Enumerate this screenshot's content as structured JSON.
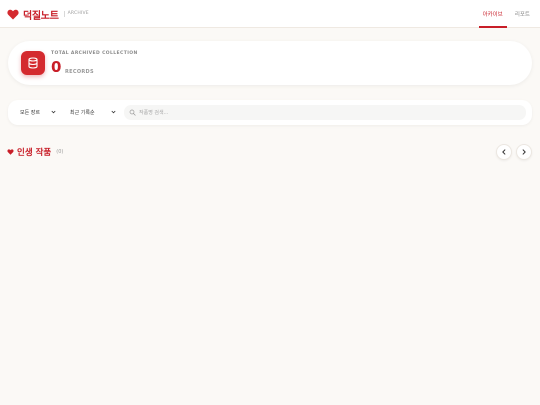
{
  "brand": {
    "name": "덕질노트",
    "sub": "ARCHIVE"
  },
  "nav": {
    "items": [
      {
        "label": "아카이브",
        "active": true
      },
      {
        "label": "리포트",
        "active": false
      }
    ]
  },
  "stats": {
    "label": "TOTAL ARCHIVED COLLECTION",
    "count": "0",
    "unit": "RECORDS"
  },
  "filters": {
    "genre_select": "모든 장르",
    "sort_select": "최근 기록순",
    "search_placeholder": "작품명 검색..."
  },
  "section": {
    "title": "인생 작품",
    "count": "(0)"
  },
  "colors": {
    "accent": "#c81e28",
    "background": "#fbf9f6"
  },
  "icons": [
    "heart-icon",
    "database-icon",
    "chevron-down-icon",
    "search-icon",
    "chevron-left-icon",
    "chevron-right-icon"
  ]
}
